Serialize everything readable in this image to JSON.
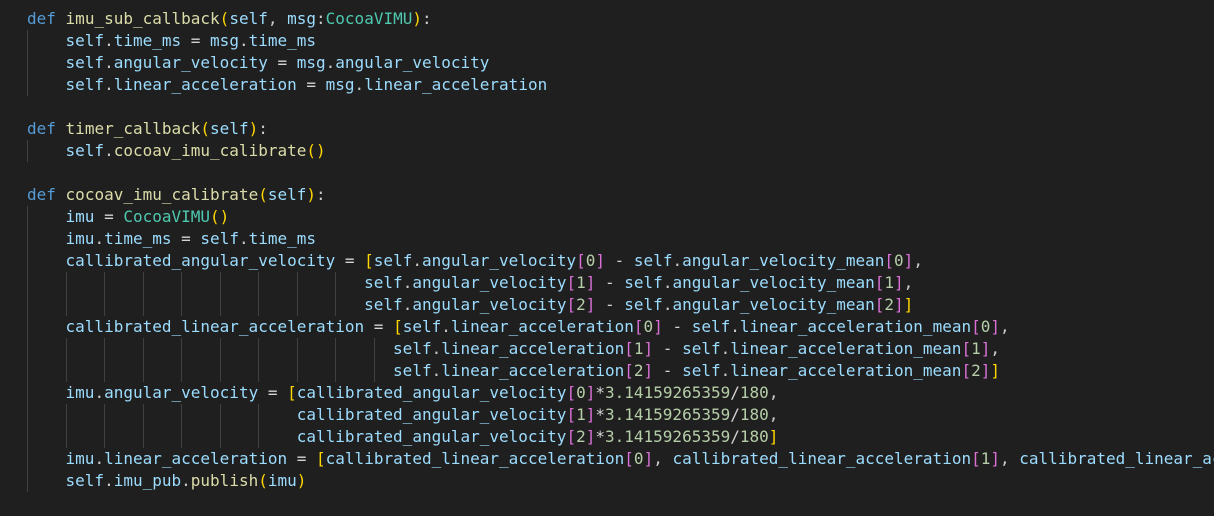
{
  "editor": {
    "language": "python",
    "theme_colors": {
      "background": "#1f1f1f",
      "keyword": "#569cd6",
      "function": "#dcdcaa",
      "variable": "#9cdcfe",
      "class": "#4ec9b0",
      "number": "#b5cea8",
      "bracket_level_1": "#ffd700",
      "bracket_level_2": "#da70d6",
      "bracket_level_3": "#179fff"
    },
    "lines": [
      {
        "tokens": [
          {
            "t": "def",
            "c": "kw"
          },
          {
            "t": " ",
            "c": "plain"
          },
          {
            "t": "imu_sub_callback",
            "c": "fn"
          },
          {
            "t": "(",
            "c": "p1"
          },
          {
            "t": "self",
            "c": "self"
          },
          {
            "t": ", ",
            "c": "plain"
          },
          {
            "t": "msg",
            "c": "var"
          },
          {
            "t": ":",
            "c": "plain"
          },
          {
            "t": "CocoaVIMU",
            "c": "cls"
          },
          {
            "t": ")",
            "c": "p1"
          },
          {
            "t": ":",
            "c": "plain"
          }
        ]
      },
      {
        "tokens": [
          {
            "t": "    ",
            "c": "plain"
          },
          {
            "t": "self",
            "c": "self"
          },
          {
            "t": ".",
            "c": "plain"
          },
          {
            "t": "time_ms",
            "c": "var"
          },
          {
            "t": " = ",
            "c": "op"
          },
          {
            "t": "msg",
            "c": "var"
          },
          {
            "t": ".",
            "c": "plain"
          },
          {
            "t": "time_ms",
            "c": "var"
          }
        ]
      },
      {
        "tokens": [
          {
            "t": "    ",
            "c": "plain"
          },
          {
            "t": "self",
            "c": "self"
          },
          {
            "t": ".",
            "c": "plain"
          },
          {
            "t": "angular_velocity",
            "c": "var"
          },
          {
            "t": " = ",
            "c": "op"
          },
          {
            "t": "msg",
            "c": "var"
          },
          {
            "t": ".",
            "c": "plain"
          },
          {
            "t": "angular_velocity",
            "c": "var"
          }
        ]
      },
      {
        "tokens": [
          {
            "t": "    ",
            "c": "plain"
          },
          {
            "t": "self",
            "c": "self"
          },
          {
            "t": ".",
            "c": "plain"
          },
          {
            "t": "linear_acceleration",
            "c": "var"
          },
          {
            "t": " = ",
            "c": "op"
          },
          {
            "t": "msg",
            "c": "var"
          },
          {
            "t": ".",
            "c": "plain"
          },
          {
            "t": "linear_acceleration",
            "c": "var"
          }
        ]
      },
      {
        "tokens": []
      },
      {
        "tokens": [
          {
            "t": "def",
            "c": "kw"
          },
          {
            "t": " ",
            "c": "plain"
          },
          {
            "t": "timer_callback",
            "c": "fn"
          },
          {
            "t": "(",
            "c": "p1"
          },
          {
            "t": "self",
            "c": "self"
          },
          {
            "t": ")",
            "c": "p1"
          },
          {
            "t": ":",
            "c": "plain"
          }
        ]
      },
      {
        "tokens": [
          {
            "t": "    ",
            "c": "plain"
          },
          {
            "t": "self",
            "c": "self"
          },
          {
            "t": ".",
            "c": "plain"
          },
          {
            "t": "cocoav_imu_calibrate",
            "c": "fn"
          },
          {
            "t": "()",
            "c": "p1"
          }
        ]
      },
      {
        "tokens": []
      },
      {
        "tokens": [
          {
            "t": "def",
            "c": "kw"
          },
          {
            "t": " ",
            "c": "plain"
          },
          {
            "t": "cocoav_imu_calibrate",
            "c": "fn"
          },
          {
            "t": "(",
            "c": "p1"
          },
          {
            "t": "self",
            "c": "self"
          },
          {
            "t": ")",
            "c": "p1"
          },
          {
            "t": ":",
            "c": "plain"
          }
        ]
      },
      {
        "tokens": [
          {
            "t": "    ",
            "c": "plain"
          },
          {
            "t": "imu",
            "c": "var"
          },
          {
            "t": " = ",
            "c": "op"
          },
          {
            "t": "CocoaVIMU",
            "c": "cls"
          },
          {
            "t": "()",
            "c": "p1"
          }
        ]
      },
      {
        "tokens": [
          {
            "t": "    ",
            "c": "plain"
          },
          {
            "t": "imu",
            "c": "var"
          },
          {
            "t": ".",
            "c": "plain"
          },
          {
            "t": "time_ms",
            "c": "var"
          },
          {
            "t": " = ",
            "c": "op"
          },
          {
            "t": "self",
            "c": "self"
          },
          {
            "t": ".",
            "c": "plain"
          },
          {
            "t": "time_ms",
            "c": "var"
          }
        ]
      },
      {
        "tokens": [
          {
            "t": "    ",
            "c": "plain"
          },
          {
            "t": "callibrated_angular_velocity",
            "c": "var"
          },
          {
            "t": " = ",
            "c": "op"
          },
          {
            "t": "[",
            "c": "p1"
          },
          {
            "t": "self",
            "c": "self"
          },
          {
            "t": ".",
            "c": "plain"
          },
          {
            "t": "angular_velocity",
            "c": "var"
          },
          {
            "t": "[",
            "c": "p2"
          },
          {
            "t": "0",
            "c": "num"
          },
          {
            "t": "]",
            "c": "p2"
          },
          {
            "t": " - ",
            "c": "op"
          },
          {
            "t": "self",
            "c": "self"
          },
          {
            "t": ".",
            "c": "plain"
          },
          {
            "t": "angular_velocity_mean",
            "c": "var"
          },
          {
            "t": "[",
            "c": "p2"
          },
          {
            "t": "0",
            "c": "num"
          },
          {
            "t": "]",
            "c": "p2"
          },
          {
            "t": ",",
            "c": "plain"
          }
        ]
      },
      {
        "tokens": [
          {
            "t": "                                   ",
            "c": "plain"
          },
          {
            "t": "self",
            "c": "self"
          },
          {
            "t": ".",
            "c": "plain"
          },
          {
            "t": "angular_velocity",
            "c": "var"
          },
          {
            "t": "[",
            "c": "p2"
          },
          {
            "t": "1",
            "c": "num"
          },
          {
            "t": "]",
            "c": "p2"
          },
          {
            "t": " - ",
            "c": "op"
          },
          {
            "t": "self",
            "c": "self"
          },
          {
            "t": ".",
            "c": "plain"
          },
          {
            "t": "angular_velocity_mean",
            "c": "var"
          },
          {
            "t": "[",
            "c": "p2"
          },
          {
            "t": "1",
            "c": "num"
          },
          {
            "t": "]",
            "c": "p2"
          },
          {
            "t": ",",
            "c": "plain"
          }
        ]
      },
      {
        "tokens": [
          {
            "t": "                                   ",
            "c": "plain"
          },
          {
            "t": "self",
            "c": "self"
          },
          {
            "t": ".",
            "c": "plain"
          },
          {
            "t": "angular_velocity",
            "c": "var"
          },
          {
            "t": "[",
            "c": "p2"
          },
          {
            "t": "2",
            "c": "num"
          },
          {
            "t": "]",
            "c": "p2"
          },
          {
            "t": " - ",
            "c": "op"
          },
          {
            "t": "self",
            "c": "self"
          },
          {
            "t": ".",
            "c": "plain"
          },
          {
            "t": "angular_velocity_mean",
            "c": "var"
          },
          {
            "t": "[",
            "c": "p2"
          },
          {
            "t": "2",
            "c": "num"
          },
          {
            "t": "]",
            "c": "p2"
          },
          {
            "t": "]",
            "c": "p1"
          }
        ]
      },
      {
        "tokens": [
          {
            "t": "    ",
            "c": "plain"
          },
          {
            "t": "callibrated_linear_acceleration",
            "c": "var"
          },
          {
            "t": " = ",
            "c": "op"
          },
          {
            "t": "[",
            "c": "p1"
          },
          {
            "t": "self",
            "c": "self"
          },
          {
            "t": ".",
            "c": "plain"
          },
          {
            "t": "linear_acceleration",
            "c": "var"
          },
          {
            "t": "[",
            "c": "p2"
          },
          {
            "t": "0",
            "c": "num"
          },
          {
            "t": "]",
            "c": "p2"
          },
          {
            "t": " - ",
            "c": "op"
          },
          {
            "t": "self",
            "c": "self"
          },
          {
            "t": ".",
            "c": "plain"
          },
          {
            "t": "linear_acceleration_mean",
            "c": "var"
          },
          {
            "t": "[",
            "c": "p2"
          },
          {
            "t": "0",
            "c": "num"
          },
          {
            "t": "]",
            "c": "p2"
          },
          {
            "t": ",",
            "c": "plain"
          }
        ]
      },
      {
        "tokens": [
          {
            "t": "                                      ",
            "c": "plain"
          },
          {
            "t": "self",
            "c": "self"
          },
          {
            "t": ".",
            "c": "plain"
          },
          {
            "t": "linear_acceleration",
            "c": "var"
          },
          {
            "t": "[",
            "c": "p2"
          },
          {
            "t": "1",
            "c": "num"
          },
          {
            "t": "]",
            "c": "p2"
          },
          {
            "t": " - ",
            "c": "op"
          },
          {
            "t": "self",
            "c": "self"
          },
          {
            "t": ".",
            "c": "plain"
          },
          {
            "t": "linear_acceleration_mean",
            "c": "var"
          },
          {
            "t": "[",
            "c": "p2"
          },
          {
            "t": "1",
            "c": "num"
          },
          {
            "t": "]",
            "c": "p2"
          },
          {
            "t": ",",
            "c": "plain"
          }
        ]
      },
      {
        "tokens": [
          {
            "t": "                                      ",
            "c": "plain"
          },
          {
            "t": "self",
            "c": "self"
          },
          {
            "t": ".",
            "c": "plain"
          },
          {
            "t": "linear_acceleration",
            "c": "var"
          },
          {
            "t": "[",
            "c": "p2"
          },
          {
            "t": "2",
            "c": "num"
          },
          {
            "t": "]",
            "c": "p2"
          },
          {
            "t": " - ",
            "c": "op"
          },
          {
            "t": "self",
            "c": "self"
          },
          {
            "t": ".",
            "c": "plain"
          },
          {
            "t": "linear_acceleration_mean",
            "c": "var"
          },
          {
            "t": "[",
            "c": "p2"
          },
          {
            "t": "2",
            "c": "num"
          },
          {
            "t": "]",
            "c": "p2"
          },
          {
            "t": "]",
            "c": "p1"
          }
        ]
      },
      {
        "tokens": [
          {
            "t": "    ",
            "c": "plain"
          },
          {
            "t": "imu",
            "c": "var"
          },
          {
            "t": ".",
            "c": "plain"
          },
          {
            "t": "angular_velocity",
            "c": "var"
          },
          {
            "t": " = ",
            "c": "op"
          },
          {
            "t": "[",
            "c": "p1"
          },
          {
            "t": "callibrated_angular_velocity",
            "c": "var"
          },
          {
            "t": "[",
            "c": "p2"
          },
          {
            "t": "0",
            "c": "num"
          },
          {
            "t": "]",
            "c": "p2"
          },
          {
            "t": "*",
            "c": "op"
          },
          {
            "t": "3.14159265359",
            "c": "num"
          },
          {
            "t": "/",
            "c": "op"
          },
          {
            "t": "180",
            "c": "num"
          },
          {
            "t": ",",
            "c": "plain"
          }
        ]
      },
      {
        "tokens": [
          {
            "t": "                            ",
            "c": "plain"
          },
          {
            "t": "callibrated_angular_velocity",
            "c": "var"
          },
          {
            "t": "[",
            "c": "p2"
          },
          {
            "t": "1",
            "c": "num"
          },
          {
            "t": "]",
            "c": "p2"
          },
          {
            "t": "*",
            "c": "op"
          },
          {
            "t": "3.14159265359",
            "c": "num"
          },
          {
            "t": "/",
            "c": "op"
          },
          {
            "t": "180",
            "c": "num"
          },
          {
            "t": ",",
            "c": "plain"
          }
        ]
      },
      {
        "tokens": [
          {
            "t": "                            ",
            "c": "plain"
          },
          {
            "t": "callibrated_angular_velocity",
            "c": "var"
          },
          {
            "t": "[",
            "c": "p2"
          },
          {
            "t": "2",
            "c": "num"
          },
          {
            "t": "]",
            "c": "p2"
          },
          {
            "t": "*",
            "c": "op"
          },
          {
            "t": "3.14159265359",
            "c": "num"
          },
          {
            "t": "/",
            "c": "op"
          },
          {
            "t": "180",
            "c": "num"
          },
          {
            "t": "]",
            "c": "p1"
          }
        ]
      },
      {
        "tokens": [
          {
            "t": "    ",
            "c": "plain"
          },
          {
            "t": "imu",
            "c": "var"
          },
          {
            "t": ".",
            "c": "plain"
          },
          {
            "t": "linear_acceleration",
            "c": "var"
          },
          {
            "t": " = ",
            "c": "op"
          },
          {
            "t": "[",
            "c": "p1"
          },
          {
            "t": "callibrated_linear_acceleration",
            "c": "var"
          },
          {
            "t": "[",
            "c": "p2"
          },
          {
            "t": "0",
            "c": "num"
          },
          {
            "t": "]",
            "c": "p2"
          },
          {
            "t": ", ",
            "c": "plain"
          },
          {
            "t": "callibrated_linear_acceleration",
            "c": "var"
          },
          {
            "t": "[",
            "c": "p2"
          },
          {
            "t": "1",
            "c": "num"
          },
          {
            "t": "]",
            "c": "p2"
          },
          {
            "t": ", ",
            "c": "plain"
          },
          {
            "t": "callibrated_linear_ac",
            "c": "var"
          }
        ]
      },
      {
        "tokens": [
          {
            "t": "    ",
            "c": "plain"
          },
          {
            "t": "self",
            "c": "self"
          },
          {
            "t": ".",
            "c": "plain"
          },
          {
            "t": "imu_pub",
            "c": "var"
          },
          {
            "t": ".",
            "c": "plain"
          },
          {
            "t": "publish",
            "c": "fn"
          },
          {
            "t": "(",
            "c": "p1"
          },
          {
            "t": "imu",
            "c": "var"
          },
          {
            "t": ")",
            "c": "p1"
          }
        ]
      }
    ]
  }
}
